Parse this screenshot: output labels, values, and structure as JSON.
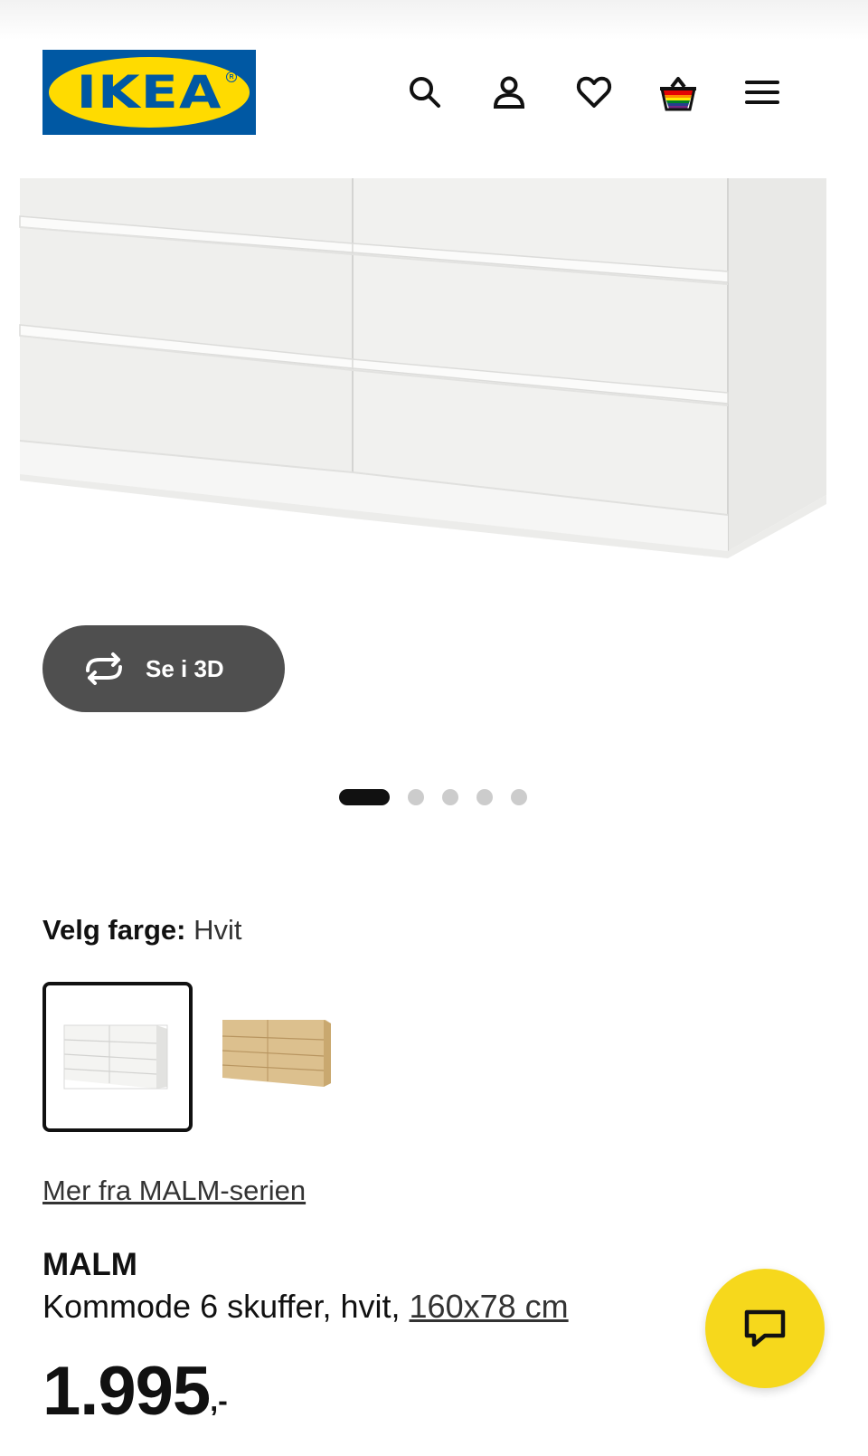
{
  "header": {
    "logo_text": "IKEA",
    "icons": [
      "search-icon",
      "user-icon",
      "heart-icon",
      "basket-icon",
      "menu-icon"
    ]
  },
  "gallery": {
    "view_3d_label": "Se i 3D",
    "dots_total": 5,
    "active_dot": 1
  },
  "color": {
    "label": "Velg farge:",
    "value": "Hvit",
    "options": [
      "white",
      "oak-veneer"
    ]
  },
  "series_link": "Mer fra MALM-serien",
  "product": {
    "name": "MALM",
    "description": "Kommode 6 skuffer, hvit, ",
    "dimensions": "160x78 cm",
    "price": "1.995",
    "price_suffix": ",-"
  },
  "colors": {
    "brand_blue": "#0058a3",
    "brand_yellow": "#ffdb00",
    "chat_yellow": "#f6d81c",
    "button_dark": "#4f4f4f"
  }
}
